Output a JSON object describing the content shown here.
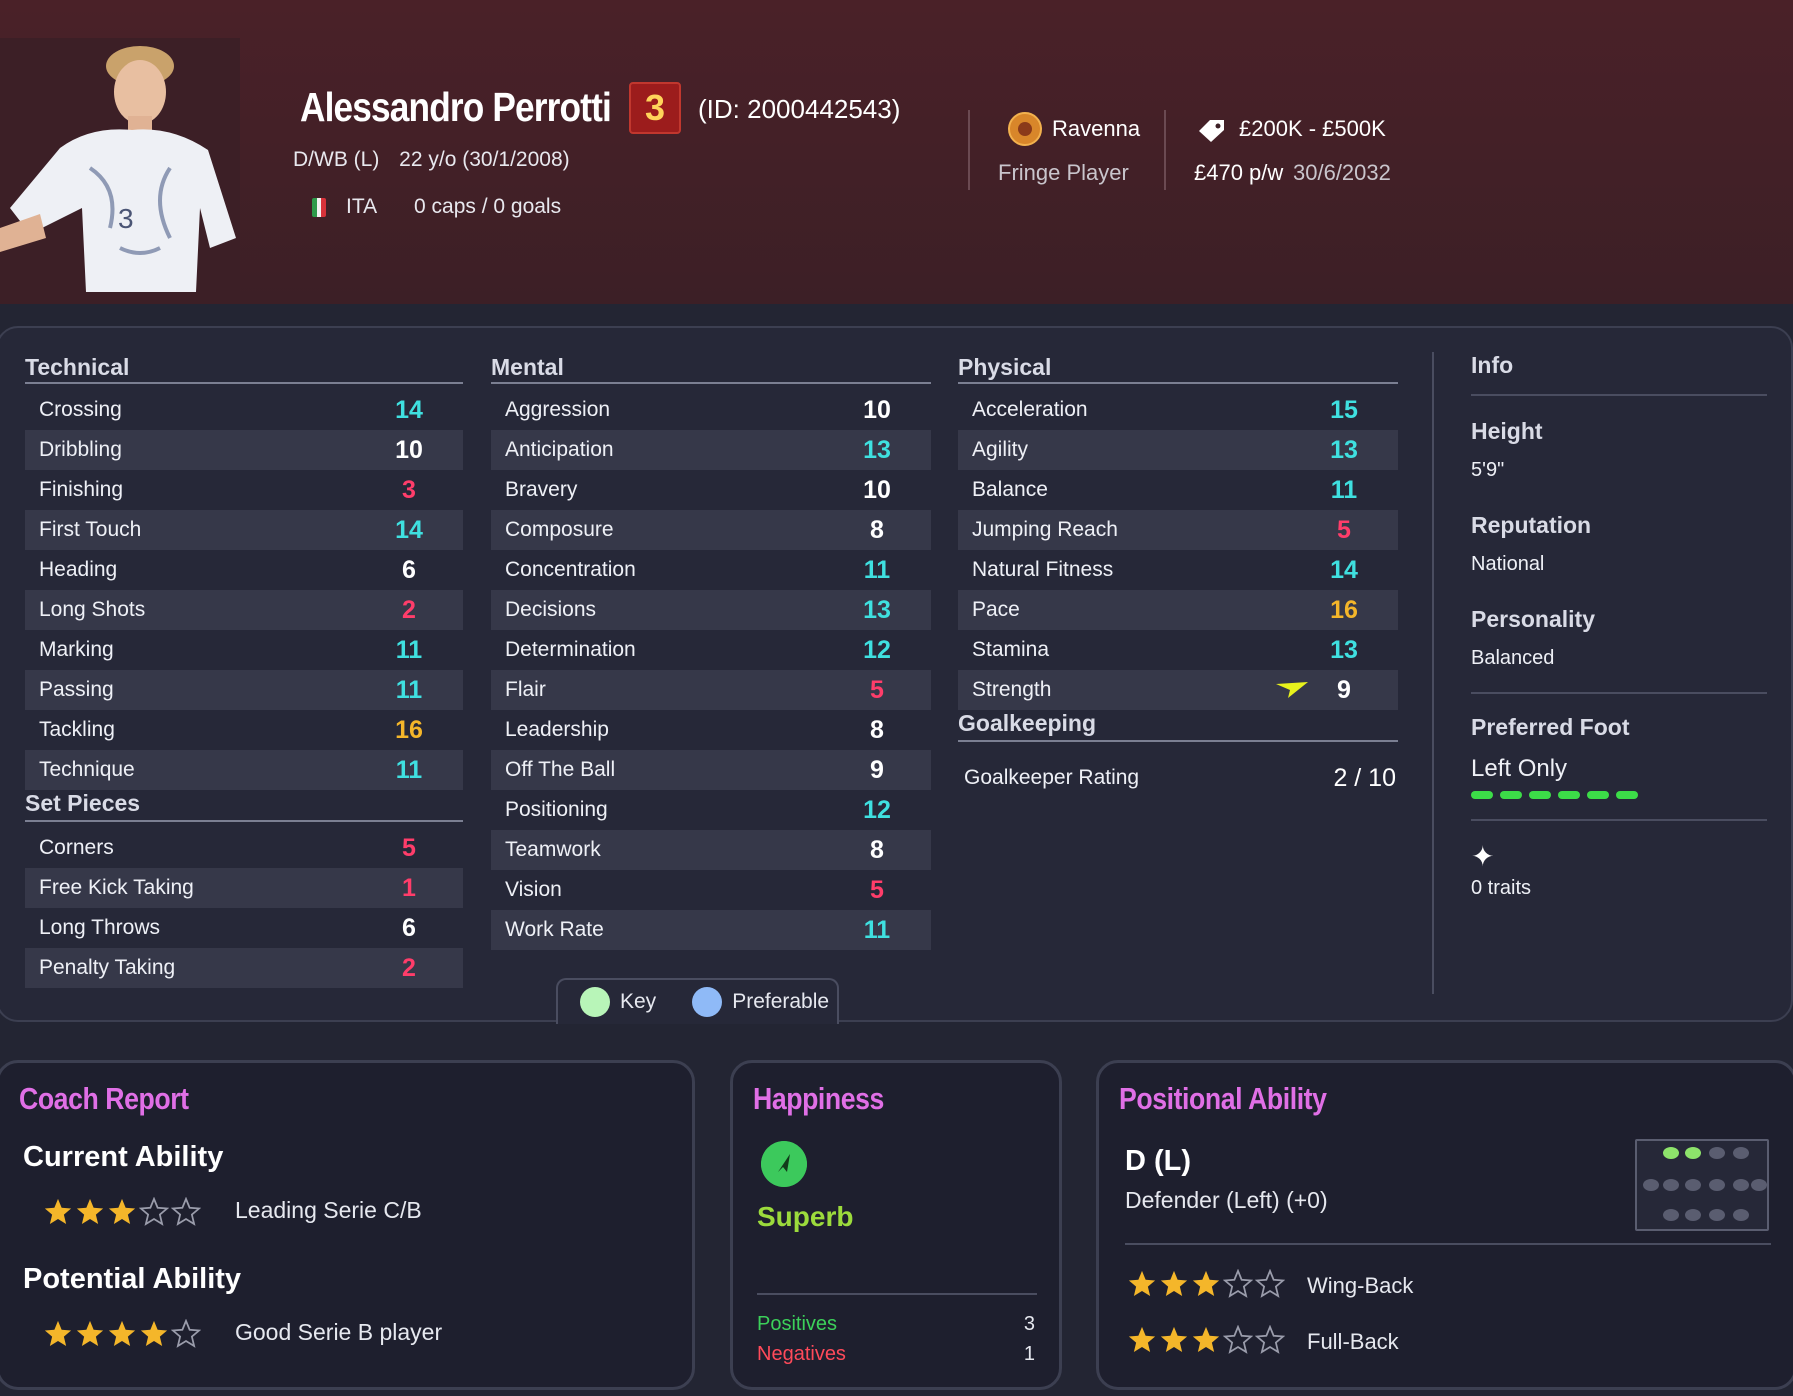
{
  "player": {
    "name": "Alessandro Perrotti",
    "number": "3",
    "id_text": "(ID: 2000442543)",
    "position": "D/WB (L)",
    "age": "22 y/o (30/1/2008)",
    "nation": "ITA",
    "caps": "0 caps / 0 goals"
  },
  "club": {
    "name": "Ravenna",
    "squad_status": "Fringe Player",
    "value": "£200K - £500K",
    "wage": "£470 p/w",
    "contract_end": "30/6/2032"
  },
  "colors": {
    "high": "#f4b62a",
    "good": "#3fe0e0",
    "average": "#ffffff",
    "low": "#ff3d6a"
  },
  "technical": {
    "title": "Technical",
    "rows": [
      {
        "label": "Crossing",
        "value": "14"
      },
      {
        "label": "Dribbling",
        "value": "10"
      },
      {
        "label": "Finishing",
        "value": "3"
      },
      {
        "label": "First Touch",
        "value": "14"
      },
      {
        "label": "Heading",
        "value": "6"
      },
      {
        "label": "Long Shots",
        "value": "2"
      },
      {
        "label": "Marking",
        "value": "11"
      },
      {
        "label": "Passing",
        "value": "11"
      },
      {
        "label": "Tackling",
        "value": "16"
      },
      {
        "label": "Technique",
        "value": "11"
      }
    ]
  },
  "set_pieces": {
    "title": "Set Pieces",
    "rows": [
      {
        "label": "Corners",
        "value": "5"
      },
      {
        "label": "Free Kick Taking",
        "value": "1"
      },
      {
        "label": "Long Throws",
        "value": "6"
      },
      {
        "label": "Penalty Taking",
        "value": "2"
      }
    ]
  },
  "mental": {
    "title": "Mental",
    "rows": [
      {
        "label": "Aggression",
        "value": "10"
      },
      {
        "label": "Anticipation",
        "value": "13"
      },
      {
        "label": "Bravery",
        "value": "10"
      },
      {
        "label": "Composure",
        "value": "8"
      },
      {
        "label": "Concentration",
        "value": "11"
      },
      {
        "label": "Decisions",
        "value": "13"
      },
      {
        "label": "Determination",
        "value": "12"
      },
      {
        "label": "Flair",
        "value": "5"
      },
      {
        "label": "Leadership",
        "value": "8"
      },
      {
        "label": "Off The Ball",
        "value": "9"
      },
      {
        "label": "Positioning",
        "value": "12"
      },
      {
        "label": "Teamwork",
        "value": "8"
      },
      {
        "label": "Vision",
        "value": "5"
      },
      {
        "label": "Work Rate",
        "value": "11"
      }
    ]
  },
  "physical": {
    "title": "Physical",
    "rows": [
      {
        "label": "Acceleration",
        "value": "15"
      },
      {
        "label": "Agility",
        "value": "13"
      },
      {
        "label": "Balance",
        "value": "11"
      },
      {
        "label": "Jumping Reach",
        "value": "5"
      },
      {
        "label": "Natural Fitness",
        "value": "14"
      },
      {
        "label": "Pace",
        "value": "16"
      },
      {
        "label": "Stamina",
        "value": "13"
      },
      {
        "label": "Strength",
        "value": "9"
      }
    ]
  },
  "goalkeeping": {
    "title": "Goalkeeping",
    "label": "Goalkeeper Rating",
    "value": "2 / 10"
  },
  "info": {
    "title": "Info",
    "height_label": "Height",
    "height": "5'9\"",
    "reputation_label": "Reputation",
    "reputation": "National",
    "personality_label": "Personality",
    "personality": "Balanced",
    "foot_label": "Preferred Foot",
    "foot": "Left Only",
    "traits": "0 traits"
  },
  "legend": {
    "key": "Key",
    "preferable": "Preferable"
  },
  "coach_report": {
    "title": "Coach Report",
    "current_label": "Current Ability",
    "current_stars": 3,
    "current_desc": "Leading Serie C/B",
    "potential_label": "Potential Ability",
    "potential_stars": 4,
    "potential_desc": "Good Serie B player"
  },
  "happiness": {
    "title": "Happiness",
    "value": "Superb",
    "positives_label": "Positives",
    "positives": "3",
    "negatives_label": "Negatives",
    "negatives": "1"
  },
  "positional": {
    "title": "Positional Ability",
    "position": "D (L)",
    "position_desc": "Defender (Left) (+0)",
    "roles": [
      {
        "name": "Wing-Back",
        "stars": 3
      },
      {
        "name": "Full-Back",
        "stars": 3
      }
    ]
  }
}
